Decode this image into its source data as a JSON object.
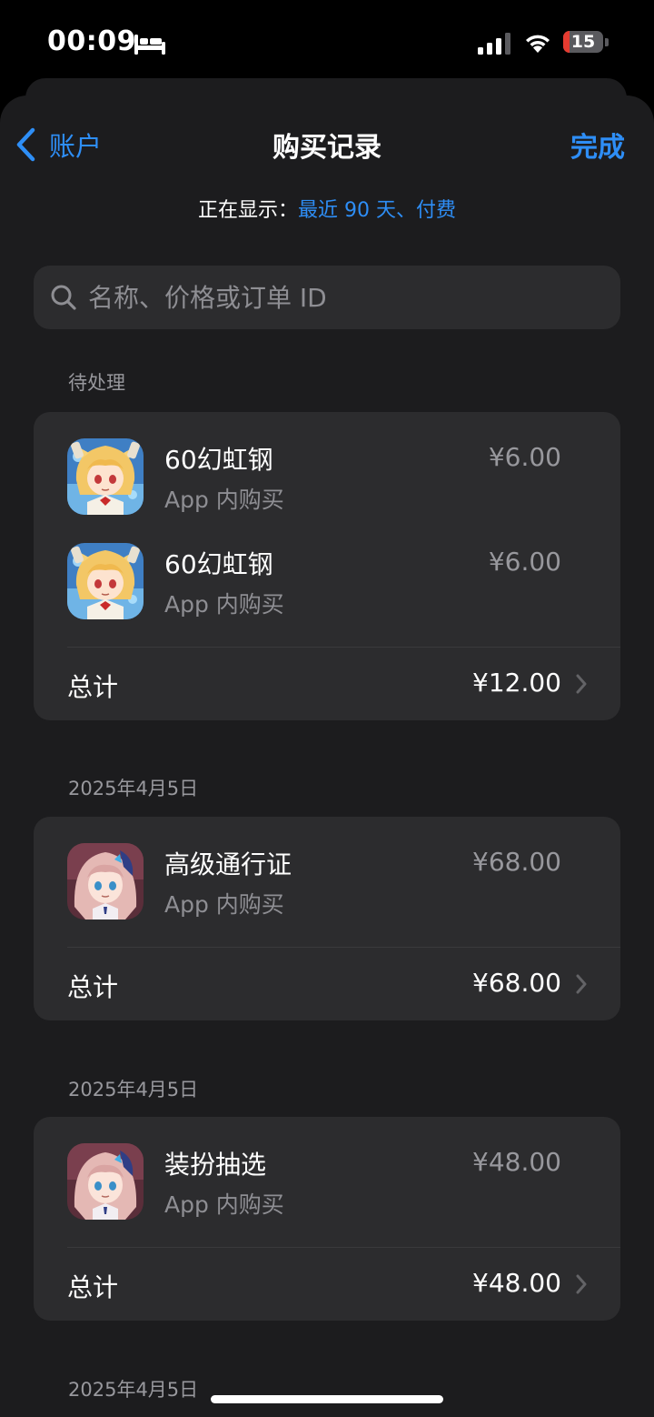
{
  "status_bar": {
    "time": "00:09",
    "battery_level": "15",
    "battery_percent": 15
  },
  "nav": {
    "back_label": "账户",
    "title": "购买记录",
    "done_label": "完成"
  },
  "filter": {
    "prefix": "正在显示：",
    "value": "最近 90 天、付费"
  },
  "search": {
    "placeholder": "名称、价格或订单 ID"
  },
  "colors": {
    "accent": "#2e8ef6",
    "background": "#1c1c1e",
    "card": "#2c2c2e",
    "secondary_text": "#8e8e93",
    "battery_low": "#e53b30"
  },
  "sections": [
    {
      "header": "待处理",
      "items": [
        {
          "name": "60幻虹钢",
          "type": "App 内购买",
          "price": "¥6.00",
          "icon": "game-icon-blonde-character"
        },
        {
          "name": "60幻虹钢",
          "type": "App 内购买",
          "price": "¥6.00",
          "icon": "game-icon-blonde-character"
        }
      ],
      "total_label": "总计",
      "total": "¥12.00"
    },
    {
      "header": "2025年4月5日",
      "items": [
        {
          "name": "高级通行证",
          "type": "App 内购买",
          "price": "¥68.00",
          "icon": "game-icon-pink-hair-character"
        }
      ],
      "total_label": "总计",
      "total": "¥68.00"
    },
    {
      "header": "2025年4月5日",
      "items": [
        {
          "name": "装扮抽选",
          "type": "App 内购买",
          "price": "¥48.00",
          "icon": "game-icon-pink-hair-character"
        }
      ],
      "total_label": "总计",
      "total": "¥48.00"
    },
    {
      "header": "2025年4月5日"
    }
  ]
}
